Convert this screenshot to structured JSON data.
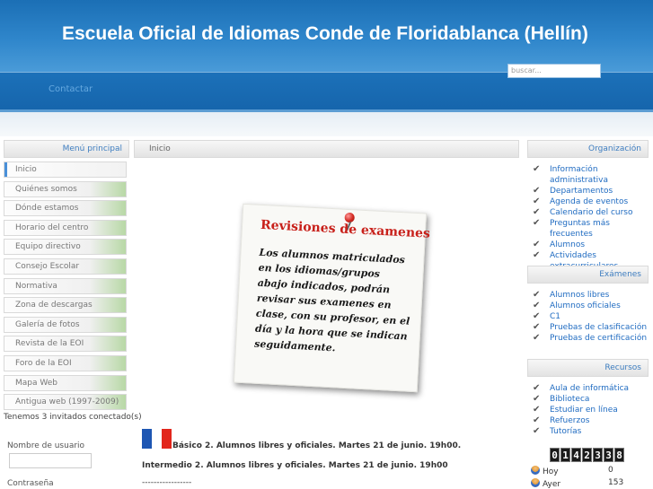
{
  "header": {
    "title": "Escuela Oficial de Idiomas Conde de Floridablanca (Hellín)",
    "search_placeholder": "buscar..."
  },
  "nav": {
    "contact_label": "Contactar"
  },
  "left": {
    "menu_title": "Menú principal",
    "menu_items": [
      "Inicio",
      "Quiénes somos",
      "Dónde estamos",
      "Horario del centro",
      "Equipo directivo",
      "Consejo Escolar",
      "Normativa",
      "Zona de descargas",
      "Galería de fotos",
      "Revista de la EOI",
      "Foro de la EOI",
      "Mapa Web",
      "Antigua web (1997-2009)"
    ],
    "guests_text": "Tenemos 3 invitados conectado(s)",
    "username_label": "Nombre de usuario",
    "password_label": "Contraseña"
  },
  "main": {
    "breadcrumb": "Inicio",
    "note": {
      "title": "Revisiones de examenes",
      "body": "Los alumnos matriculados en los idiomas/grupos abajo indicados, podrán revisar sus examenes en clase, con su profesor, en el día y la hora que se indican seguidamente."
    },
    "announcement_1": "Básico 2. Alumnos libres y oficiales. Martes 21 de junio. 19h00.",
    "announcement_2": "Intermedio 2. Alumnos libres y oficiales. Martes 21 de junio. 19h00",
    "separator": "-----------------"
  },
  "right": {
    "organizacion": {
      "title": "Organización",
      "items": [
        "Información administrativa",
        "Departamentos",
        "Agenda de eventos",
        "Calendario del curso",
        "Preguntas más frecuentes",
        "Alumnos",
        "Actividades extracurriculares"
      ]
    },
    "examenes": {
      "title": "Exámenes",
      "items": [
        "Alumnos libres",
        "Alumnos oficiales",
        "C1",
        "Pruebas de clasificación",
        "Pruebas de certificación"
      ]
    },
    "recursos": {
      "title": "Recursos",
      "items": [
        "Aula de informática",
        "Biblioteca",
        "Estudiar en línea",
        "Refuerzos",
        "Tutorías"
      ]
    },
    "counter_digits": [
      "0",
      "1",
      "4",
      "2",
      "3",
      "3",
      "8"
    ],
    "stats": [
      {
        "label": "Hoy",
        "value": "0"
      },
      {
        "label": "Ayer",
        "value": "153"
      }
    ]
  },
  "colors": {
    "header_blue": "#1b6fb5",
    "link_blue": "#1f6bc1",
    "note_red": "#c8201a"
  }
}
